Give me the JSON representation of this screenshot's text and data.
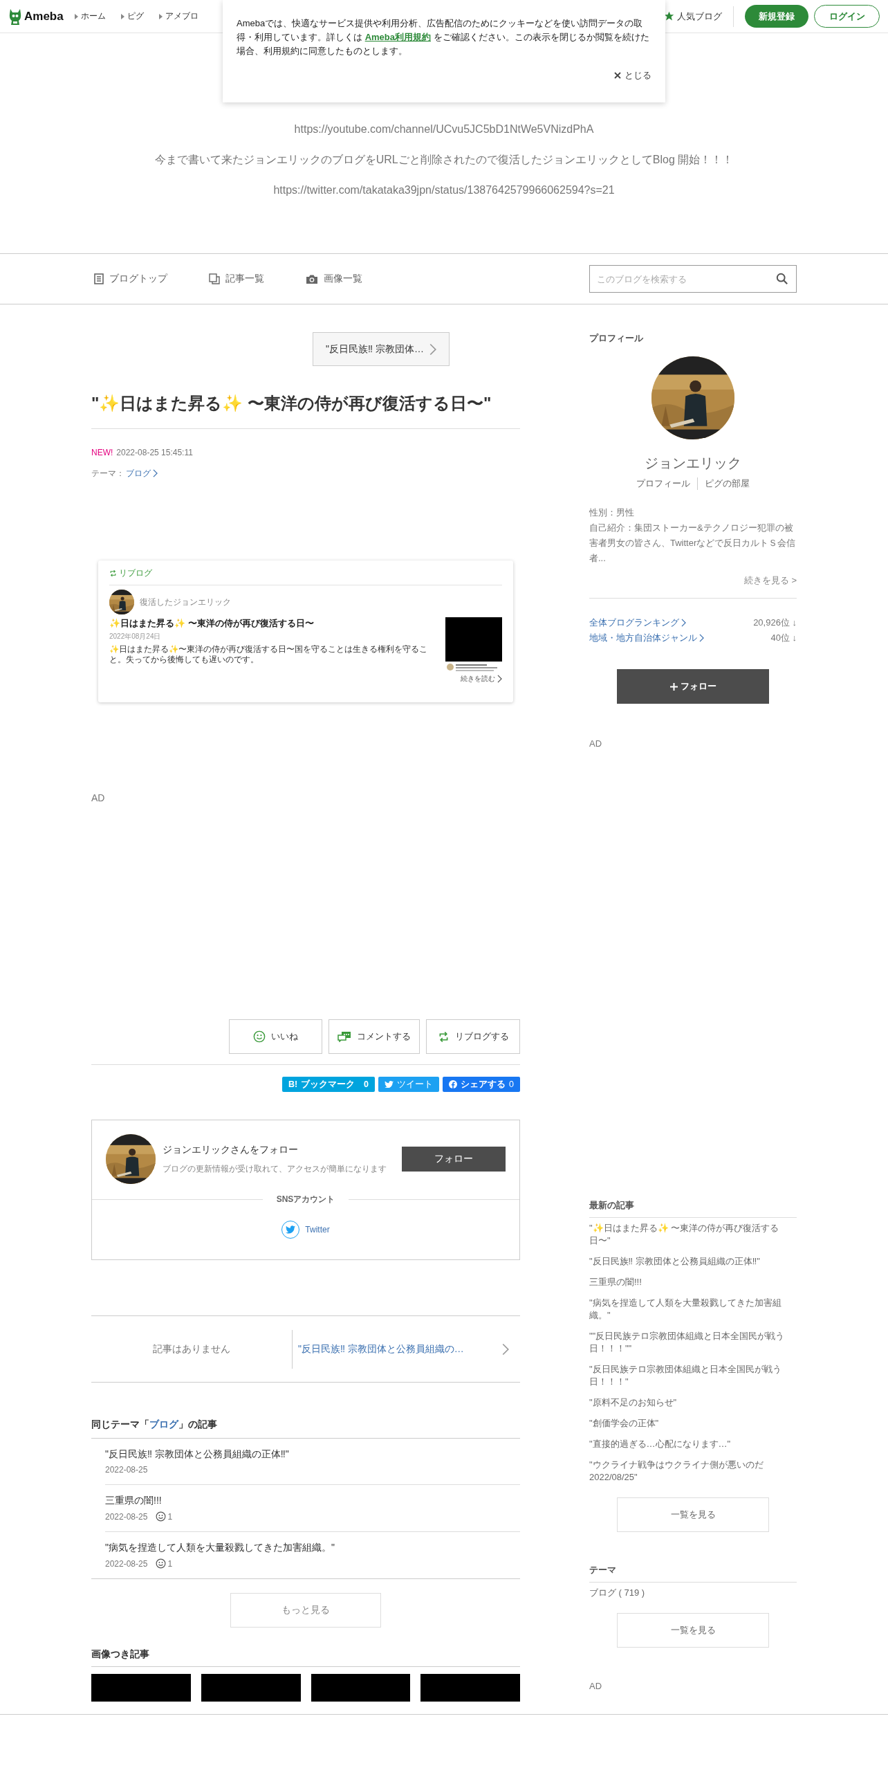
{
  "header": {
    "logo": "Ameba",
    "nav": [
      "ホーム",
      "ピグ",
      "アメブロ"
    ],
    "popular": "人気ブログ",
    "signup": "新規登録",
    "login": "ログイン"
  },
  "cookie_notice": {
    "text_before": "Amebaでは、快適なサービス提供や利用分析、広告配信のためにクッキーなどを使い訪問データの取得・利用しています。詳しくは ",
    "link": "Ameba利用規約",
    "text_after": " をご確認ください。この表示を閉じるか閲覧を続けた場合、利用規約に同意したものとします。",
    "close": "とじる"
  },
  "blog": {
    "lines": [
      "https://youtube.com/channel/UCvu5JC5bD1NtWe5VNizdPhA",
      "今まで書いて来たジョンエリックのブログをURLごと削除されたので復活したジョンエリックとしてBlog 開始！！！",
      "https://twitter.com/takataka39jpn/status/1387642579966062594?s=21"
    ]
  },
  "blog_nav": {
    "items": [
      {
        "label": "ブログトップ",
        "kind": "document"
      },
      {
        "label": "記事一覧",
        "kind": "pages"
      },
      {
        "label": "画像一覧",
        "kind": "camera"
      }
    ],
    "search": {
      "placeholder": "このブログを検索する"
    }
  },
  "article": {
    "prev_link": "\"反日民族‼ 宗教団体…",
    "title": "\"✨日はまた昇る✨ 〜東洋の侍が再び復活する日〜\"",
    "new_badge": "NEW!",
    "date": "2022-08-25 15:45:11",
    "theme_label": "テーマ：",
    "theme": "ブログ",
    "reblog": {
      "label": "リブログ",
      "author": "復活したジョンエリック",
      "title": "✨日はまた昇る✨ 〜東洋の侍が再び復活する日〜",
      "date": "2022年08月24日",
      "excerpt": "✨日はまた昇る✨〜東洋の侍が再び復活する日〜国を守ることは生きる権利を守ること。失ってから後悔しても遅いのです。",
      "more": "続きを読む"
    },
    "ad_label": "AD",
    "actions": [
      {
        "label": "いいね",
        "kind": "like"
      },
      {
        "label": "コメントする",
        "kind": "comment"
      },
      {
        "label": "リブログする",
        "kind": "reblog"
      }
    ],
    "share": [
      {
        "kind": "hatena",
        "mark": "B!",
        "label": "ブックマーク",
        "count": "0"
      },
      {
        "kind": "twitter",
        "label": "ツイート"
      },
      {
        "kind": "facebook",
        "label": "シェアする",
        "count": "0"
      }
    ]
  },
  "follow_card": {
    "title": "ジョンエリックさんをフォロー",
    "subtitle": "ブログの更新情報が受け取れて、アクセスが簡単になります",
    "button": "フォロー",
    "sns_heading": "SNSアカウント",
    "sns": [
      {
        "label": "Twitter",
        "kind": "twitter"
      }
    ]
  },
  "pager": {
    "prev": "記事はありません",
    "next": "\"反日民族‼ 宗教団体と公務員組織の…"
  },
  "same_theme": {
    "heading_before": "同じテーマ「",
    "theme": "ブログ",
    "heading_after": "」の記事",
    "items": [
      {
        "title": "\"反日民族‼ 宗教団体と公務員組織の正体‼\"",
        "date": "2022-08-25"
      },
      {
        "title": "三重県の闇!!!",
        "date": "2022-08-25",
        "likes": "1"
      },
      {
        "title": "\"病気を捏造して人類を大量殺戮してきた加害組織。\"",
        "date": "2022-08-25",
        "likes": "1"
      }
    ],
    "more": "もっと見る"
  },
  "image_articles": {
    "heading": "画像つき記事",
    "images": [
      {
        "kind": "placeholder"
      },
      {
        "kind": "placeholder"
      },
      {
        "kind": "placeholder"
      },
      {
        "kind": "placeholder"
      }
    ]
  },
  "sidebar": {
    "profile": {
      "heading": "プロフィール",
      "name": "ジョンエリック",
      "links": [
        "プロフィール",
        "ピグの部屋"
      ],
      "gender": "性別：男性",
      "intro": "自己紹介：集団ストーカー&テクノロジー犯罪の被害者男女の皆さん、Twitterなどで反日カルトＳ会信者...",
      "more": "続きを見る >",
      "rankings": [
        {
          "label": "全体ブログランキング",
          "value": "20,926位 ↓"
        },
        {
          "label": "地域・地方自治体ジャンル",
          "value": "40位 ↓"
        }
      ],
      "follow": "フォロー"
    },
    "ad_labels": [
      "AD",
      "AD"
    ],
    "latest": {
      "heading": "最新の記事",
      "items": [
        "\"✨日はまた昇る✨ 〜東洋の侍が再び復活する日〜\"",
        "\"反日民族‼ 宗教団体と公務員組織の正体‼\"",
        "三重県の闇!!!",
        "\"病気を捏造して人類を大量殺戮してきた加害組織。\"",
        "\"\"反日民族テロ宗教団体組織と日本全国民が戦う日！！！\"\"",
        "\"反日民族テロ宗教団体組織と日本全国民が戦う日！！！\"",
        "\"原料不足のお知らせ\"",
        "\"創価学会の正体\"",
        "\"直接的過ぎる…心配になります…\"",
        "\"ウクライナ戦争はウクライナ側が悪いのだ 2022/08/25\""
      ],
      "button": "一覧を見る"
    },
    "themes": {
      "heading": "テーマ",
      "items": [
        "ブログ ( 719 )"
      ],
      "button": "一覧を見る"
    }
  }
}
